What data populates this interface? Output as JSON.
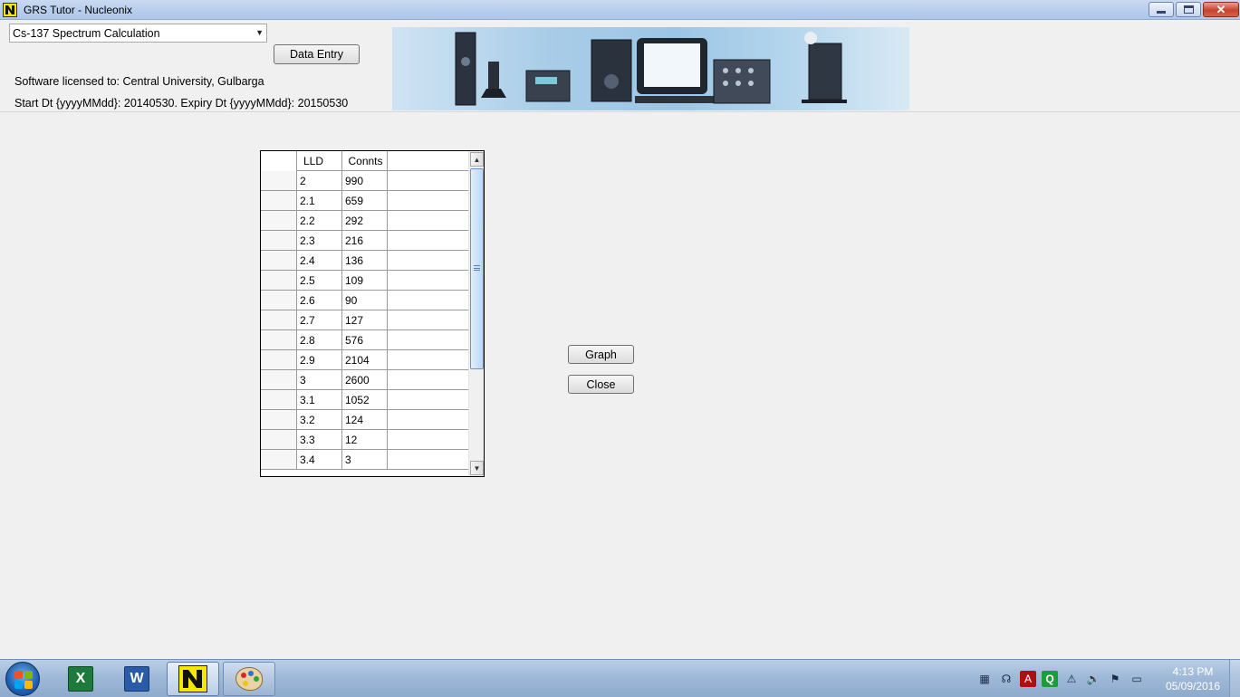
{
  "window": {
    "title": "GRS Tutor - Nucleonix",
    "app_icon": "nucleonix-logo-icon",
    "controls": [
      "minimize-icon",
      "maximize-icon",
      "close-icon"
    ],
    "close_glyph": "✕"
  },
  "header": {
    "mode_selected": "Cs-137 Spectrum Calculation",
    "data_entry_label": "Data Entry",
    "license_text": "Software licensed to: Central University, Gulbarga",
    "dates_text": "Start Dt {yyyyMMdd}: 20140530. Expiry Dt {yyyyMMdd}: 20150530"
  },
  "grid": {
    "columns": [
      "LLD",
      "Connts"
    ],
    "rows": [
      [
        "2",
        "990"
      ],
      [
        "2.1",
        "659"
      ],
      [
        "2.2",
        "292"
      ],
      [
        "2.3",
        "216"
      ],
      [
        "2.4",
        "136"
      ],
      [
        "2.5",
        "109"
      ],
      [
        "2.6",
        "90"
      ],
      [
        "2.7",
        "127"
      ],
      [
        "2.8",
        "576"
      ],
      [
        "2.9",
        "2104"
      ],
      [
        "3",
        "2600"
      ],
      [
        "3.1",
        "1052"
      ],
      [
        "3.2",
        "124"
      ],
      [
        "3.3",
        "12"
      ],
      [
        "3.4",
        "3"
      ]
    ]
  },
  "actions": {
    "graph_label": "Graph",
    "close_label": "Close"
  },
  "taskbar": {
    "items": [
      "excel-icon",
      "word-icon",
      "nucleonix-icon",
      "paint-icon"
    ],
    "tray_icons": [
      "action-center-icon",
      "network-icon",
      "acrobat-icon",
      "q-icon",
      "security-icon",
      "volume-icon",
      "flag-icon",
      "display-icon"
    ],
    "time": "4:13 PM",
    "date": "05/09/2016"
  },
  "colors": {
    "title_bar": "#b9cfee",
    "panel_bg": "#f0f0f0",
    "taskbar": "#9fb9d8",
    "app_yellow": "#f5e800"
  }
}
